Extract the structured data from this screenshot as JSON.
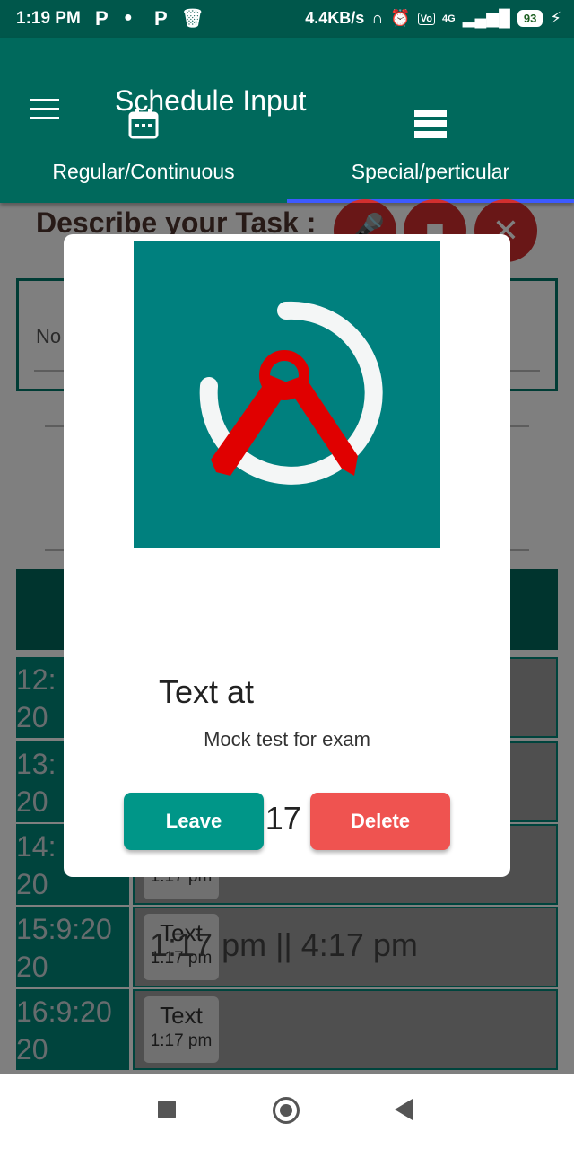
{
  "status_bar": {
    "time": "1:19 PM",
    "notif_icons": [
      "P",
      "P"
    ],
    "net_speed": "4.4KB/s",
    "network": "4G",
    "battery": "93"
  },
  "app_bar": {
    "title": "Schedule Input",
    "tabs": [
      {
        "label": "Regular/Continuous",
        "icon": "calendar-icon"
      },
      {
        "label": "Special/perticular",
        "icon": "list-icon"
      }
    ]
  },
  "background": {
    "describe_label": "Describe your Task :",
    "input_label_partial": "No",
    "rows": [
      {
        "time_l1": "12:",
        "time_l2": "20"
      },
      {
        "time_l1": "13:",
        "time_l2": "20"
      },
      {
        "time_l1": "14:",
        "time_l2": "20",
        "chip_sub": "1:17 pm"
      },
      {
        "time_l1": "15:9:20",
        "time_l2": "20",
        "chip_title": "Text",
        "chip_sub": "1:17 pm"
      },
      {
        "time_l1": "16:9:20",
        "time_l2": "20",
        "chip_title": "Text",
        "chip_sub": "1:17 pm"
      }
    ]
  },
  "dialog": {
    "title_line1": "Text at",
    "title_line2": "Time: 1:17 pm",
    "title_line3": "1:17 pm || 4:17 pm",
    "description": "Mock test for exam",
    "leave_label": "Leave",
    "delete_label": "Delete"
  },
  "colors": {
    "status_bar": "#00574b",
    "app_bar": "#00695c",
    "logo_bg": "#00807e",
    "leave": "#009688",
    "delete": "#ef5350"
  }
}
